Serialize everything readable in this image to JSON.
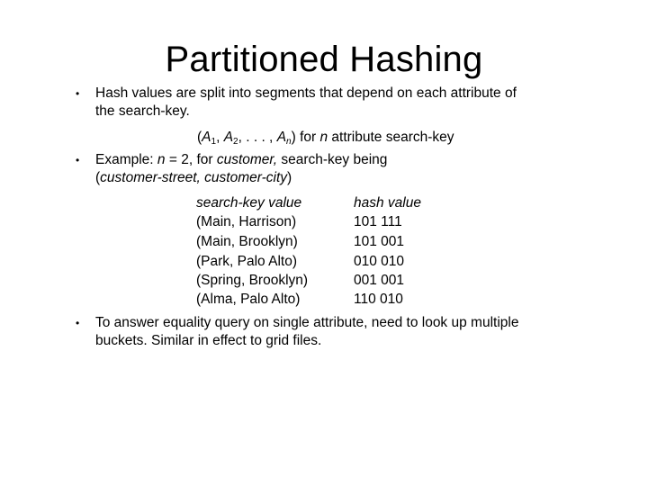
{
  "slide": {
    "title": "Partitioned Hashing",
    "bullets": [
      {
        "line1": "Hash values are split into segments that depend on each attribute of",
        "line2": "the search-key."
      },
      {
        "line1_prefix": "Example:  ",
        "line1_n": "n",
        "line1_eq": " = 2, for ",
        "line1_customer": "customer,",
        "line1_rest": "  search-key being",
        "line2_open": "(",
        "line2_italic": "customer-street, customer-city",
        "line2_close": ")"
      },
      {
        "line1": "To answer equality query on single attribute, need to look up multiple",
        "line2": "buckets.  Similar in effect to grid files."
      }
    ],
    "formula": {
      "open": "(",
      "a": "A",
      "s1": "1",
      "sep1": ", ",
      "s2": "2",
      "dots": ", . . . , ",
      "sn": "n",
      "close": ")",
      "for": " for ",
      "n": "n",
      "rest": " attribute search-key"
    },
    "table": {
      "headers": [
        "search-key value",
        "hash value"
      ],
      "rows": [
        [
          "(Main, Harrison)",
          "101 111"
        ],
        [
          "(Main, Brooklyn)",
          "101 001"
        ],
        [
          "(Park, Palo Alto)",
          "010 010"
        ],
        [
          "(Spring, Brooklyn)",
          "001 001"
        ],
        [
          "(Alma, Palo Alto)",
          "110 010"
        ]
      ]
    }
  }
}
